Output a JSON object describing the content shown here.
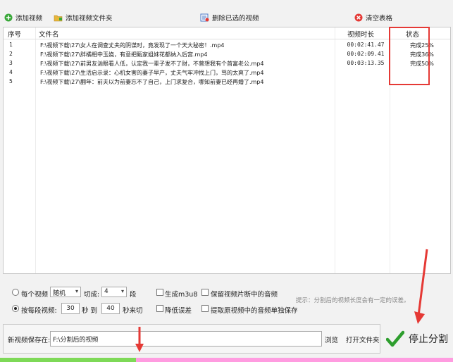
{
  "toolbar": {
    "add_video": "添加视频",
    "add_folder": "添加视频文件夹",
    "delete_selected": "删除已选的视频",
    "clear_table": "清空表格"
  },
  "table": {
    "headers": {
      "seq": "序号",
      "filename": "文件名",
      "duration": "视频时长",
      "status": "状态"
    },
    "rows": [
      {
        "seq": "1",
        "filename": "F:\\视频下载\\27\\女人在调查丈夫的阴谋时，竟发现了一个天大秘密！.mp4",
        "duration": "00:02:41.47",
        "status": "完成25%"
      },
      {
        "seq": "2",
        "filename": "F:\\视频下载\\27\\胖橘相中玉娆，有意把甄家姐妹花都纳入后宫.mp4",
        "duration": "00:02:09.41",
        "status": "完成36%"
      },
      {
        "seq": "3",
        "filename": "F:\\视频下载\\27\\前男友汹眼看人低，认定我一辈子发不了财，不曾想我有个首富老公.mp4",
        "duration": "00:03:13.35",
        "status": "完成50%"
      },
      {
        "seq": "4",
        "filename": "F:\\视频下载\\27\\生活启示录：心机女害的妻子早产，丈夫气牢冲找上门，骂的太爽了.mp4",
        "duration": "",
        "status": ""
      },
      {
        "seq": "5",
        "filename": "F:\\视频下载\\27\\翻年：前夫以为前妻忘不了自己，上门求复合，哪知前妻已经再婚了.mp4",
        "duration": "",
        "status": ""
      }
    ]
  },
  "options": {
    "per_video_label": "每个视频",
    "mode_value": "随机",
    "cut_label": "切成:",
    "segments_value": "4",
    "segment_unit": "段",
    "per_segment_label": "按每段视频:",
    "min_value": "30",
    "sec_to": "秒 到",
    "max_value": "40",
    "sec_cut": "秒来切",
    "gen_m3u8": "生成m3u8",
    "reduce_error": "降低误差",
    "keep_audio": "保留视频片断中的音频",
    "extract_audio": "提取原视频中的音频单独保存",
    "hint": "提示：分割后的视频长度会有一定的误差。"
  },
  "save": {
    "label": "新视频保存在:",
    "path": "F:\\分割后的视频",
    "browse": "浏览",
    "open_folder": "打开文件夹"
  },
  "stop_button": "停止分割",
  "progress": {
    "fraction": 0.3
  },
  "colors": {
    "annotation": "#e53935",
    "progress_fill": "#7ed957",
    "progress_track": "#ff9ce0"
  }
}
